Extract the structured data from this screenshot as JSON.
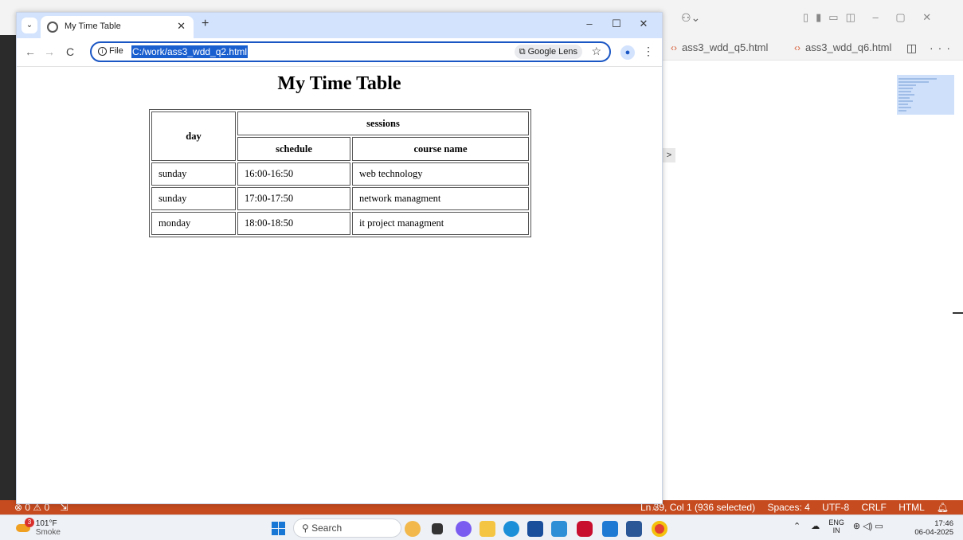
{
  "vscode": {
    "tabs": [
      {
        "label": "ass3_wdd_q5.html"
      },
      {
        "label": "ass3_wdd_q6.html"
      }
    ],
    "tab_actions": "◫ ···",
    "copilot_icon": "copilot-icon",
    "expand_arrow": ">",
    "statusbar": {
      "errors": "⊗ 0 ⚠ 0",
      "ports": "⇲",
      "cursor": "Ln 39, Col 1 (936 selected)",
      "spaces": "Spaces: 4",
      "encoding": "UTF-8",
      "eol": "CRLF",
      "language": "HTML",
      "accent": "#c64b1f"
    }
  },
  "browser": {
    "tab": {
      "title": "My Time Table",
      "close": "✕"
    },
    "new_tab": "+",
    "window_controls": {
      "minimize": "–",
      "maximize": "☐",
      "close": "✕"
    },
    "nav": {
      "back": "←",
      "forward": "→",
      "reload": "C"
    },
    "address_bar": {
      "site_label": "File",
      "url": "C:/work/ass3_wdd_q2.html",
      "lens_label": "Google Lens",
      "star": "☆"
    },
    "menu": "⋮"
  },
  "page": {
    "heading": "My Time Table",
    "table": {
      "header": {
        "day": "day",
        "sessions": "sessions",
        "schedule": "schedule",
        "course_name": "course name"
      },
      "rows": [
        {
          "day": "sunday",
          "schedule": "16:00-16:50",
          "course": "web technology"
        },
        {
          "day": "sunday",
          "schedule": "17:00-17:50",
          "course": "network managment"
        },
        {
          "day": "monday",
          "schedule": "18:00-18:50",
          "course": "it project managment"
        }
      ]
    }
  },
  "taskbar": {
    "weather": {
      "badge": "3",
      "temp": "101°F",
      "condition": "Smoke"
    },
    "search_label": "Search",
    "tray": {
      "lang_top": "ENG",
      "lang_bottom": "IN"
    },
    "clock": {
      "time": "17:46",
      "date": "06-04-2025"
    }
  }
}
